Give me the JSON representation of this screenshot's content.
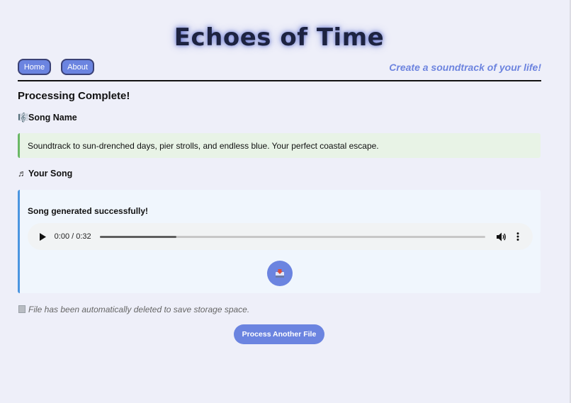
{
  "header": {
    "title": "Echoes of Time",
    "tagline": "Create a soundtrack of your life!"
  },
  "nav": {
    "items": [
      {
        "label": "Home"
      },
      {
        "label": "About"
      }
    ]
  },
  "main": {
    "status_heading": "Processing Complete!",
    "song_name_heading": "Song Name",
    "song_name_icon": "🎼",
    "song_name_text": "Soundtrack to sun-drenched days, pier strolls, and endless blue. Your perfect coastal escape.",
    "your_song_heading": "Your Song",
    "your_song_icon": "♬",
    "success_message": "Song generated successfully!",
    "audio": {
      "time_display": "0:00 / 0:32",
      "progress_fraction": 0.2
    },
    "deleted_note": "File has been automatically deleted to save storage space.",
    "process_another_label": "Process Another File"
  },
  "colors": {
    "accent": "#6b84e0",
    "success_border": "#6bb866",
    "info_border": "#4b95e0",
    "background": "#eeeff9"
  },
  "icons": {
    "play": "play-icon",
    "volume": "volume-icon",
    "more": "more-vertical-icon",
    "download": "download-icon",
    "trash": "trash-icon"
  }
}
